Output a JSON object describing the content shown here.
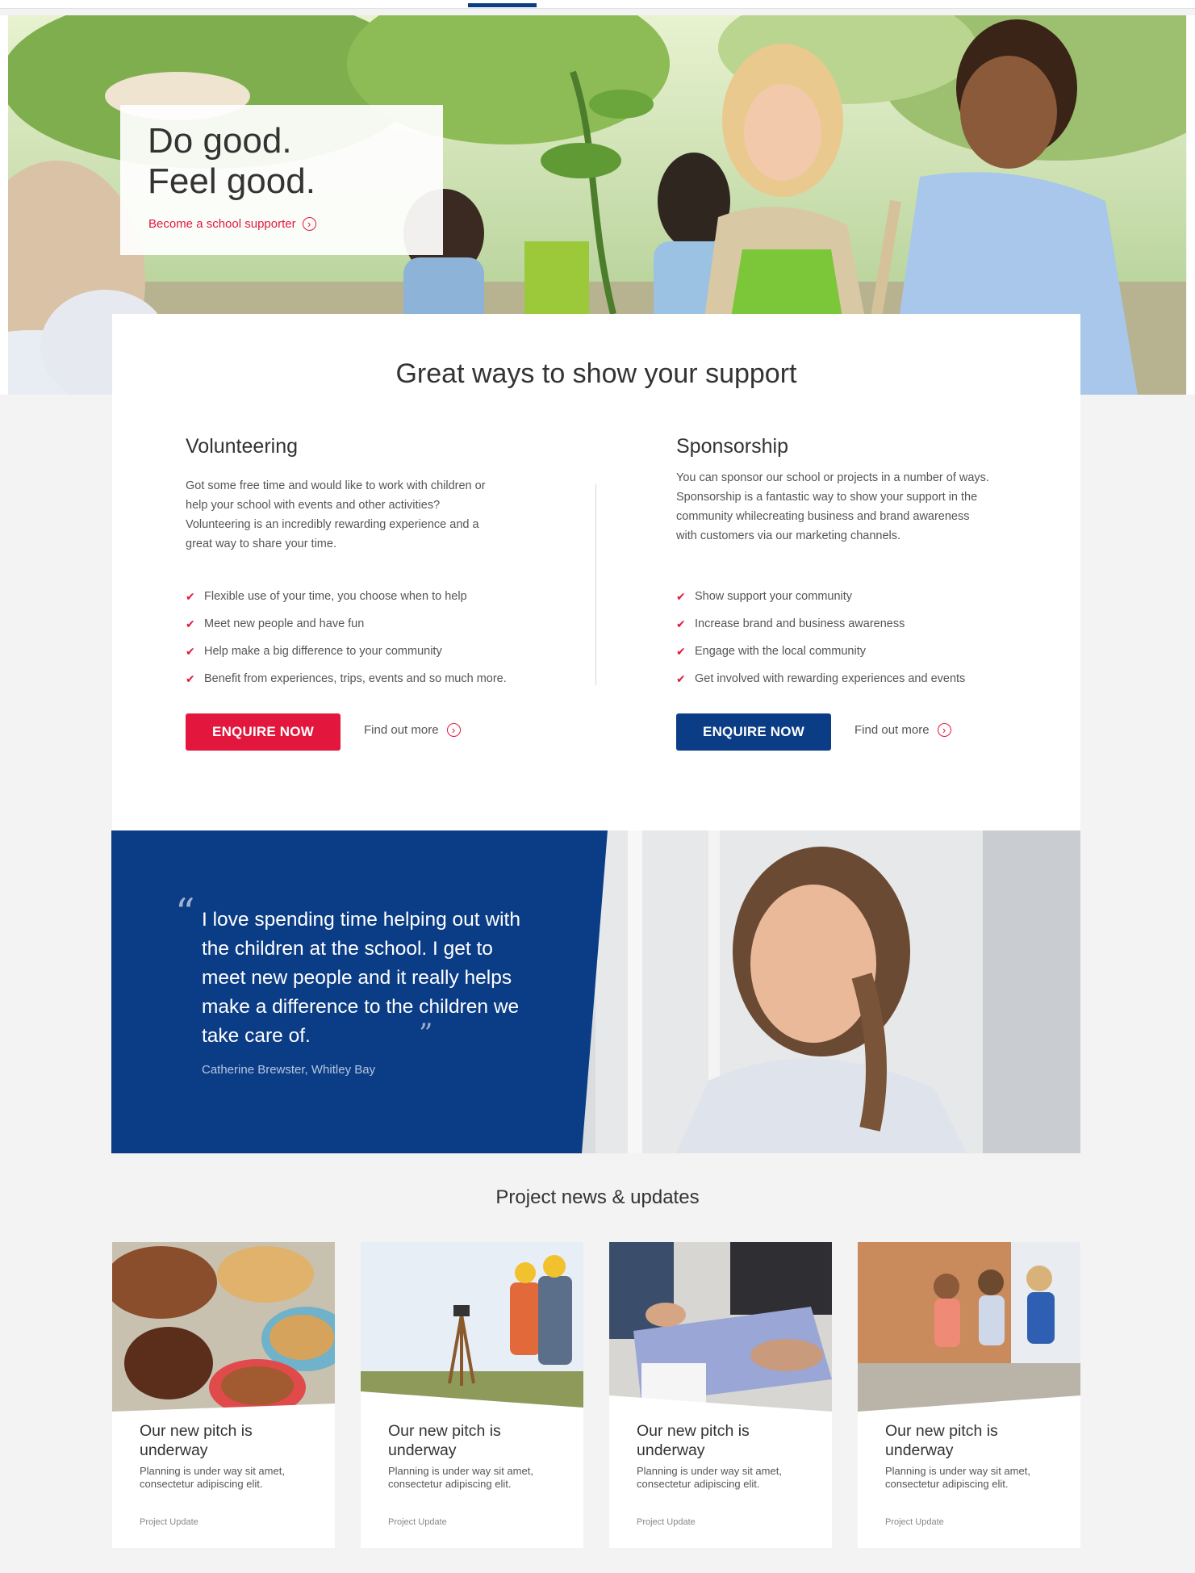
{
  "hero": {
    "title_line1": "Do good.",
    "title_line2": "Feel good.",
    "cta": "Become a school supporter"
  },
  "support": {
    "title": "Great ways to show your support",
    "volunteering": {
      "heading": "Volunteering",
      "text": "Got some free time and would like to work with children or help your school with events and other activities? Volunteering is an incredibly rewarding experience and a great way to share your time.",
      "benefits": [
        "Flexible use of your time, you choose when to help",
        "Meet new people and have fun",
        "Help make a big difference to your community",
        "Benefit from experiences, trips, events and so much more."
      ],
      "button": "ENQUIRE NOW",
      "more": "Find out more"
    },
    "sponsorship": {
      "heading": "Sponsorship",
      "text": "You can sponsor our school or projects in a number of ways. Sponsorship is a fantastic way to show your support in the community whilecreating business and brand awareness with customers via our marketing channels.",
      "benefits": [
        "Show support your community",
        "Increase brand and business awareness",
        "Engage with the local community",
        "Get involved with rewarding experiences and events"
      ],
      "button": "ENQUIRE NOW",
      "more": "Find out more"
    }
  },
  "testimonial": {
    "quote": "I love spending time helping out with the children at the school. I get to meet new people and it really helps make a difference to the children we take care of.",
    "author": "Catherine Brewster, Whitley Bay"
  },
  "news": {
    "title": "Project news & updates",
    "cards": [
      {
        "heading": "Our new pitch is underway",
        "text": "Planning is under way sit amet, consectetur adipiscing elit.",
        "tag": "Project Update"
      },
      {
        "heading": "Our new pitch is underway",
        "text": "Planning is under way sit amet, consectetur adipiscing elit.",
        "tag": "Project Update"
      },
      {
        "heading": "Our new pitch is underway",
        "text": "Planning is under way sit amet, consectetur adipiscing elit.",
        "tag": "Project Update"
      },
      {
        "heading": "Our new pitch is underway",
        "text": "Planning is under way sit amet, consectetur adipiscing elit.",
        "tag": "Project Update"
      }
    ]
  },
  "colors": {
    "accent_red": "#e3173e",
    "brand_blue": "#0b3d86",
    "page_bg": "#f3f3f3"
  }
}
